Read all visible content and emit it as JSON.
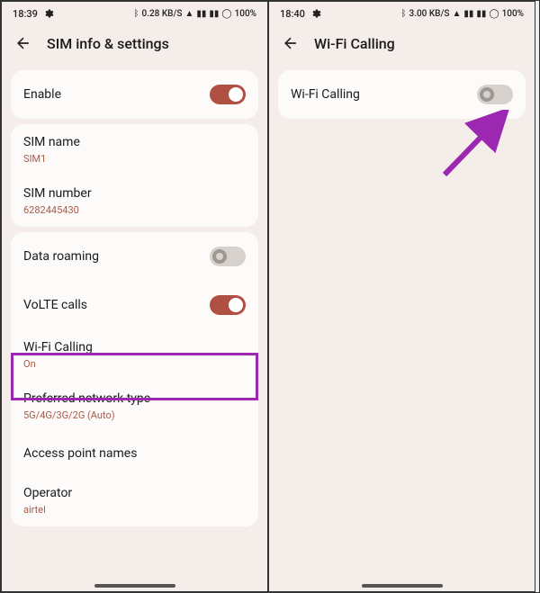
{
  "screen1": {
    "status": {
      "time": "18:39",
      "right": "0.28 KB/S",
      "battery": "100%"
    },
    "header": {
      "title": "SIM info & settings"
    },
    "enable": {
      "label": "Enable"
    },
    "sim": {
      "name_label": "SIM name",
      "name_value": "SIM1",
      "number_label": "SIM number",
      "number_value": "6282445430"
    },
    "network": {
      "roaming": "Data roaming",
      "volte": "VoLTE calls",
      "wifi_calling": "Wi-Fi Calling",
      "wifi_calling_state": "On",
      "pref_type": "Preferred network type",
      "pref_type_value": "5G/4G/3G/2G (Auto)",
      "apn": "Access point names",
      "operator": "Operator",
      "operator_value": "airtel"
    }
  },
  "screen2": {
    "status": {
      "time": "18:40",
      "right": "3.00 KB/S",
      "battery": "100%"
    },
    "header": {
      "title": "Wi-Fi Calling"
    },
    "wifi_calling": {
      "label": "Wi-Fi Calling"
    }
  }
}
